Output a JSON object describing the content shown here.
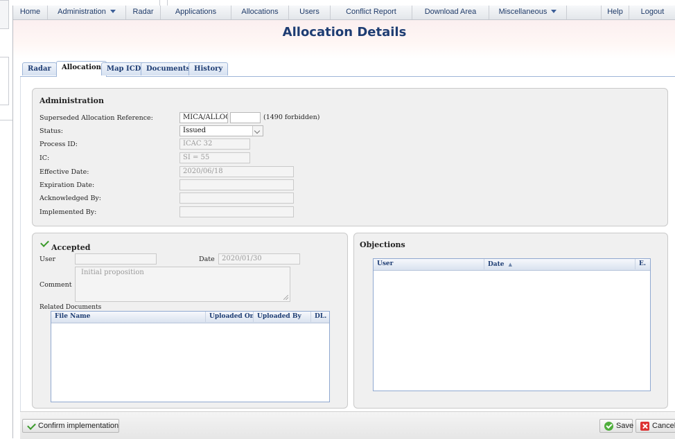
{
  "nav": {
    "home": "Home",
    "administration": "Administration",
    "radar": "Radar",
    "applications": "Applications",
    "allocations": "Allocations",
    "users": "Users",
    "conflict_report": "Conflict Report",
    "download_area": "Download Area",
    "miscellaneous": "Miscellaneous",
    "help": "Help",
    "logout": "Logout"
  },
  "page_title": "Allocation Details",
  "tabs": [
    "Radar",
    "Allocation",
    "Map ICD",
    "Documents",
    "History"
  ],
  "active_tab": "Allocation",
  "administration": {
    "title": "Administration",
    "superseded_label": "Superseded Allocation Reference:",
    "superseded_value": "MICA/ALLOC",
    "superseded_value2": "",
    "superseded_note": "(1490 forbidden)",
    "status_label": "Status:",
    "status_value": "Issued",
    "process_id_label": "Process ID:",
    "process_id_value": "ICAC 32",
    "ic_label": "IC:",
    "ic_value": "SI = 55",
    "effective_date_label": "Effective Date:",
    "effective_date_value": "2020/06/18",
    "expiration_date_label": "Expiration Date:",
    "expiration_date_value": "",
    "acknowledged_by_label": "Acknowledged By:",
    "acknowledged_by_value": "",
    "implemented_by_label": "Implemented By:",
    "implemented_by_value": ""
  },
  "accepted": {
    "title": "Accepted",
    "user_label": "User",
    "user_value": "",
    "date_label": "Date",
    "date_value": "2020/01/30",
    "comment_label": "Comment",
    "comment_value": "Initial proposition",
    "related_documents_label": "Related Documents",
    "columns": [
      "File Name",
      "Uploaded On",
      "Uploaded By",
      "DL."
    ]
  },
  "objections": {
    "title": "Objections",
    "columns": [
      "User",
      "Date",
      "E."
    ],
    "sort_indicator": "▲"
  },
  "buttons": {
    "confirm_implementation": "Confirm implementation",
    "save": "Save",
    "cancel": "Cancel"
  },
  "colors": {
    "accent": "#1e3d73",
    "success": "#3a9a2a",
    "danger": "#dd3333"
  }
}
